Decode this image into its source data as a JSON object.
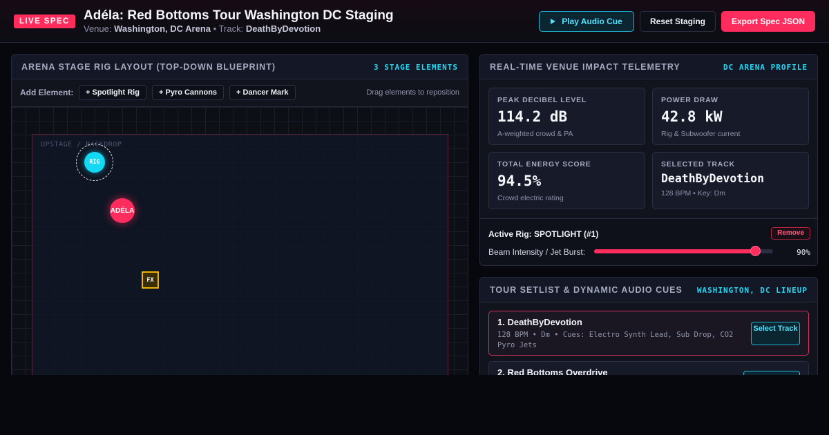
{
  "header": {
    "badge": "LIVE SPEC",
    "title": "Adéla: Red Bottoms Tour Washington DC Staging",
    "venue_prefix": "Venue:",
    "venue": "Washington, DC Arena",
    "track_prefix": "• Track:",
    "track": "DeathByDevotion",
    "play_label": "Play Audio Cue",
    "reset_label": "Reset Staging",
    "export_label": "Export Spec JSON"
  },
  "stage_panel": {
    "title": "ARENA STAGE RIG LAYOUT (TOP-DOWN BLUEPRINT)",
    "tag": "3 STAGE ELEMENTS",
    "add_label": "Add Element:",
    "add_buttons": [
      "+ Spotlight Rig",
      "+ Pyro Cannons",
      "+ Dancer Mark"
    ],
    "hint": "Drag elements to reposition",
    "stage_label": "UPSTAGE / BACKDROP",
    "elements": {
      "rig": "RIG",
      "dancer": "ADÉLA",
      "pyro": "FX"
    }
  },
  "telemetry": {
    "title": "REAL-TIME VENUE IMPACT TELEMETRY",
    "tag": "DC ARENA PROFILE",
    "cards": [
      {
        "label": "PEAK DECIBEL LEVEL",
        "value": "114.2 dB",
        "sub": "A-weighted crowd & PA"
      },
      {
        "label": "POWER DRAW",
        "value": "42.8 kW",
        "sub": "Rig & Subwoofer current"
      },
      {
        "label": "TOTAL ENERGY SCORE",
        "value": "94.5%",
        "sub": "Crowd electric rating"
      },
      {
        "label": "SELECTED TRACK",
        "value": "DeathByDevotion",
        "sub": "128 BPM • Key: Dm"
      }
    ],
    "active_rig": "Active Rig: SPOTLIGHT (#1)",
    "remove_label": "Remove",
    "slider_label": "Beam Intensity / Jet Burst:",
    "slider_value": 90,
    "slider_value_text": "90%"
  },
  "setlist": {
    "title": "TOUR SETLIST & DYNAMIC AUDIO CUES",
    "tag": "WASHINGTON, DC LINEUP",
    "select_label": "Select Track",
    "songs": [
      {
        "title": "1. DeathByDevotion",
        "meta": "128 BPM • Dm • Cues: Electro Synth Lead, Sub Drop, CO2 Pyro Jets"
      },
      {
        "title": "2. Red Bottoms Overdrive",
        "meta": ""
      }
    ]
  },
  "colors": {
    "accent_pink": "#ff2d5e",
    "accent_cyan": "#26d8f4",
    "pyro_gold": "#f0b400"
  }
}
